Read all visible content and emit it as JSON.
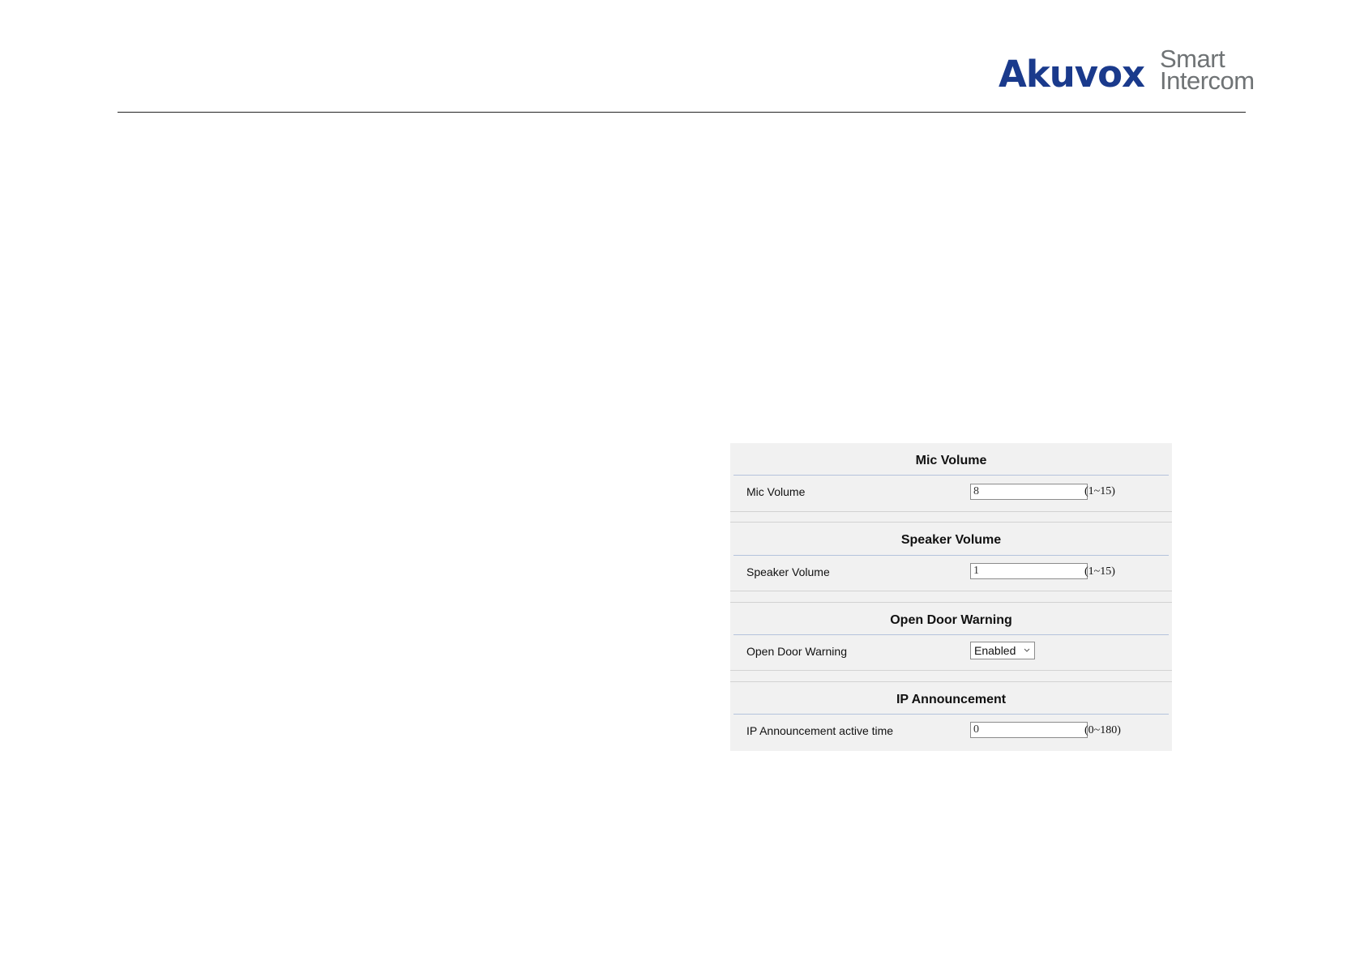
{
  "header": {
    "brand": "Akuvox",
    "tagline_line1": "Smart",
    "tagline_line2": "Intercom",
    "brand_color": "#1a3a8c",
    "tagline_color": "#6f7375"
  },
  "panel": {
    "background": "#f1f1f1",
    "sections": [
      {
        "title": "Mic Volume",
        "label": "Mic Volume",
        "value": "8",
        "range": "(1~15)"
      },
      {
        "title": "Speaker Volume",
        "label": "Speaker Volume",
        "value": "1",
        "range": "(1~15)"
      },
      {
        "title": "Open Door Warning",
        "label": "Open Door Warning",
        "selected": "Enabled",
        "control_icon": "chevron-down-icon"
      },
      {
        "title": "IP Announcement",
        "label": "IP Announcement active time",
        "value": "0",
        "range": "(0~180)"
      }
    ]
  }
}
